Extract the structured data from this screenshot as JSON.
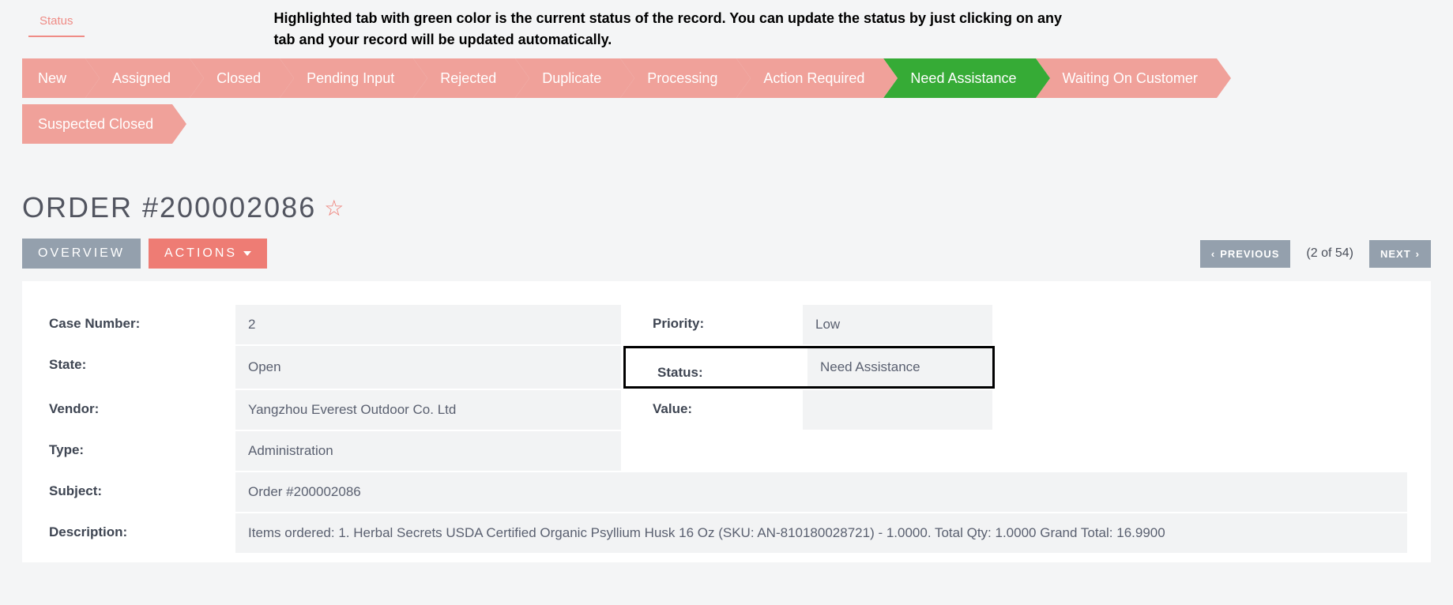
{
  "status_section": {
    "tab_label": "Status",
    "hint": "Highlighted tab with green color is the current status of the record. You can update the status by just clicking on any tab and your record will be updated automatically.",
    "active": "Need Assistance",
    "items": [
      "New",
      "Assigned",
      "Closed",
      "Pending Input",
      "Rejected",
      "Duplicate",
      "Processing",
      "Action Required",
      "Need Assistance",
      "Waiting On Customer",
      "Suspected Closed"
    ]
  },
  "title": "ORDER #200002086",
  "tabs": {
    "overview": "OVERVIEW",
    "actions": "ACTIONS"
  },
  "pager": {
    "prev": "PREVIOUS",
    "count": "(2 of 54)",
    "next": "NEXT"
  },
  "fields": {
    "left": [
      {
        "label": "Case Number:",
        "value": "2"
      },
      {
        "label": "State:",
        "value": "Open"
      },
      {
        "label": "Vendor:",
        "value": "Yangzhou Everest Outdoor Co. Ltd"
      },
      {
        "label": "Type:",
        "value": "Administration"
      },
      {
        "label": "Subject:",
        "value": "Order #200002086"
      },
      {
        "label": "Description:",
        "value": "Items ordered: 1. Herbal Secrets USDA Certified Organic Psyllium Husk 16 Oz (SKU: AN-810180028721) - 1.0000. Total Qty: 1.0000 Grand Total: 16.9900"
      }
    ],
    "right": [
      {
        "label": "Priority:",
        "value": "Low"
      },
      {
        "label": "Status:",
        "value": "Need Assistance",
        "highlight": true
      },
      {
        "label": "Value:",
        "value": ""
      }
    ]
  }
}
